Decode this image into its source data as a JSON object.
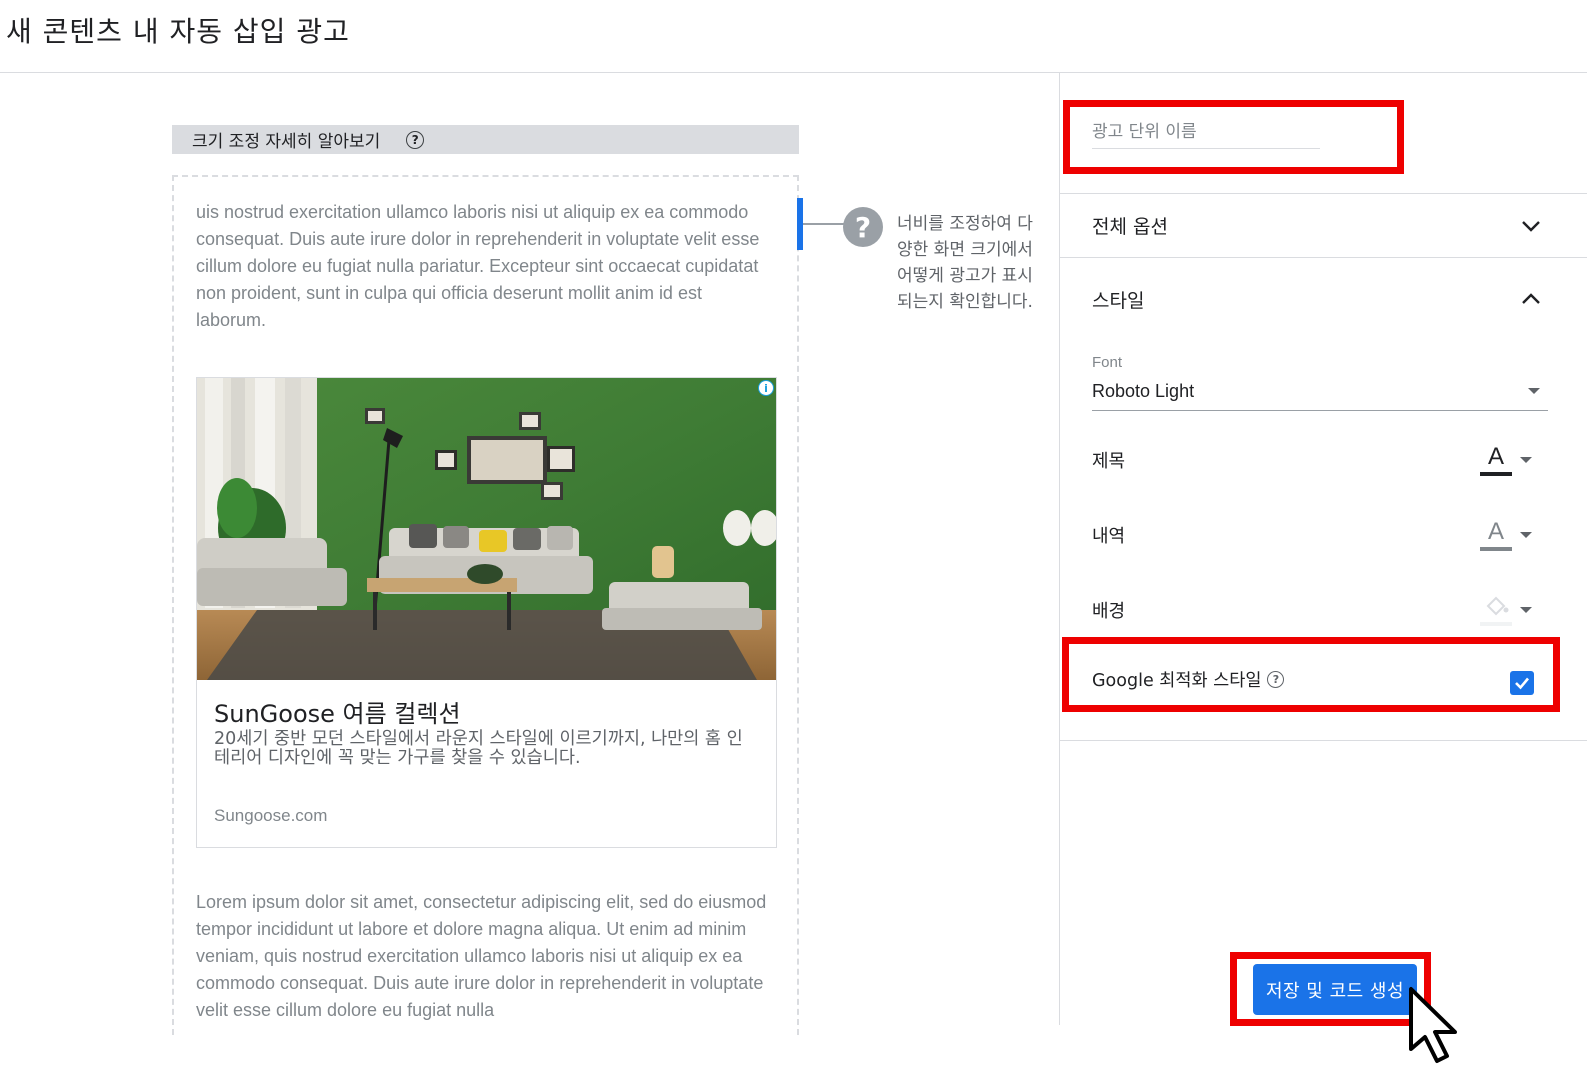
{
  "page": {
    "title": "새 콘텐츠 내 자동 삽입 광고"
  },
  "preview": {
    "resize_label": "크기 조정 자세히 알아보기",
    "help_glyph": "?",
    "lorem_top": "uis nostrud exercitation ullamco laboris nisi ut aliquip ex ea commodo consequat. Duis aute irure dolor in reprehenderit in voluptate velit esse cillum dolore eu fugiat nulla pariatur. Excepteur sint occaecat cupidatat non proident, sunt in culpa qui officia deserunt mollit anim id est laborum.",
    "lorem_bottom": "Lorem ipsum dolor sit amet, consectetur adipiscing elit, sed do eiusmod tempor incididunt ut labore et dolore magna aliqua. Ut enim ad minim veniam, quis nostrud exercitation ullamco laboris nisi ut aliquip ex ea commodo consequat. Duis aute irure dolor in reprehenderit in voluptate velit esse cillum dolore eu fugiat nulla",
    "hint_text": "너비를 조정하여 다양한 화면 크기에서 어떻게 광고가 표시되는지 확인합니다.",
    "hint_glyph": "?"
  },
  "ad": {
    "info_glyph": "i",
    "headline": "SunGoose 여름 컬렉션",
    "description": "20세기 중반 모던 스타일에서 라운지 스타일에 이르기까지, 나만의 홈 인테리어 디자인에 꼭 맞는 가구를 찾을 수 있습니다.",
    "url": "Sungoose.com"
  },
  "panel": {
    "ad_unit_name_placeholder": "광고 단위 이름",
    "general_options_label": "전체 옵션",
    "style_label": "스타일",
    "font_caption": "Font",
    "font_value": "Roboto Light",
    "title_label": "제목",
    "description_label": "내역",
    "background_label": "배경",
    "google_optimized_label": "Google 최적화 스타일",
    "google_optimized_checked": true,
    "color_glyph": "A"
  },
  "actions": {
    "save_label": "저장 및 코드 생성"
  },
  "colors": {
    "accent": "#1a73e8",
    "highlight": "#ee0000",
    "title_color_swatch": "#202124",
    "description_color_swatch": "#80868b",
    "background_color_swatch": "#f1f3f4"
  }
}
